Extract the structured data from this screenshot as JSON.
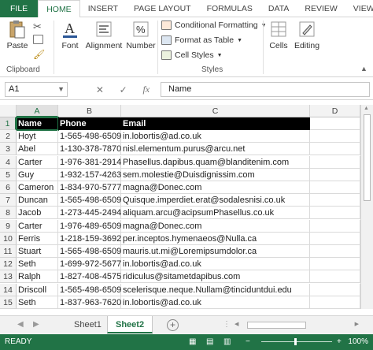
{
  "ribbon_tabs": [
    "FILE",
    "HOME",
    "INSERT",
    "PAGE LAYOUT",
    "FORMULAS",
    "DATA",
    "REVIEW",
    "VIEW"
  ],
  "ribbon": {
    "paste": "Paste",
    "clipboard": "Clipboard",
    "font": "Font",
    "alignment": "Alignment",
    "number": "Number",
    "cond_format": "Conditional Formatting",
    "format_table": "Format as Table",
    "cell_styles": "Cell Styles",
    "styles": "Styles",
    "cells": "Cells",
    "editing": "Editing"
  },
  "formula_bar": {
    "name_box": "A1",
    "fx": "fx",
    "content": "Name"
  },
  "columns": [
    "A",
    "B",
    "C",
    "D"
  ],
  "rows": [
    "1",
    "2",
    "3",
    "4",
    "5",
    "6",
    "7",
    "8",
    "9",
    "10",
    "11",
    "12",
    "13",
    "14",
    "15"
  ],
  "table": [
    [
      "Name",
      "Phone",
      "Email"
    ],
    [
      "Hoyt",
      "1-565-498-6509",
      "in.lobortis@ad.co.uk"
    ],
    [
      "Abel",
      "1-130-378-7870",
      "nisl.elementum.purus@arcu.net"
    ],
    [
      "Carter",
      "1-976-381-2914",
      "Phasellus.dapibus.quam@blanditenim.com"
    ],
    [
      "Guy",
      "1-932-157-4263",
      "sem.molestie@Duisdignissim.com"
    ],
    [
      "Cameron",
      "1-834-970-5777",
      "magna@Donec.com"
    ],
    [
      "Duncan",
      "1-565-498-6509",
      "Quisque.imperdiet.erat@sodalesnisi.co.uk"
    ],
    [
      "Jacob",
      "1-273-445-2494",
      "aliquam.arcu@acipsumPhasellus.co.uk"
    ],
    [
      "Carter",
      "1-976-489-6509",
      "magna@Donec.com"
    ],
    [
      "Ferris",
      "1-218-159-3692",
      "per.inceptos.hymenaeos@Nulla.ca"
    ],
    [
      "Stuart",
      "1-565-498-6509",
      "mauris.ut.mi@Loremipsumdolor.ca"
    ],
    [
      "Seth",
      "1-699-972-5677",
      "in.lobortis@ad.co.uk"
    ],
    [
      "Ralph",
      "1-827-408-4575",
      "ridiculus@sitametdapibus.com"
    ],
    [
      "Driscoll",
      "1-565-498-6509",
      "scelerisque.neque.Nullam@tinciduntdui.edu"
    ],
    [
      "Seth",
      "1-837-963-7620",
      "in.lobortis@ad.co.uk"
    ]
  ],
  "sheets": [
    "Sheet1",
    "Sheet2"
  ],
  "active_sheet": "Sheet2",
  "status": {
    "ready": "READY",
    "zoom": "100%"
  },
  "colors": {
    "accent": "#217346",
    "header_row_bg": "#000000"
  }
}
